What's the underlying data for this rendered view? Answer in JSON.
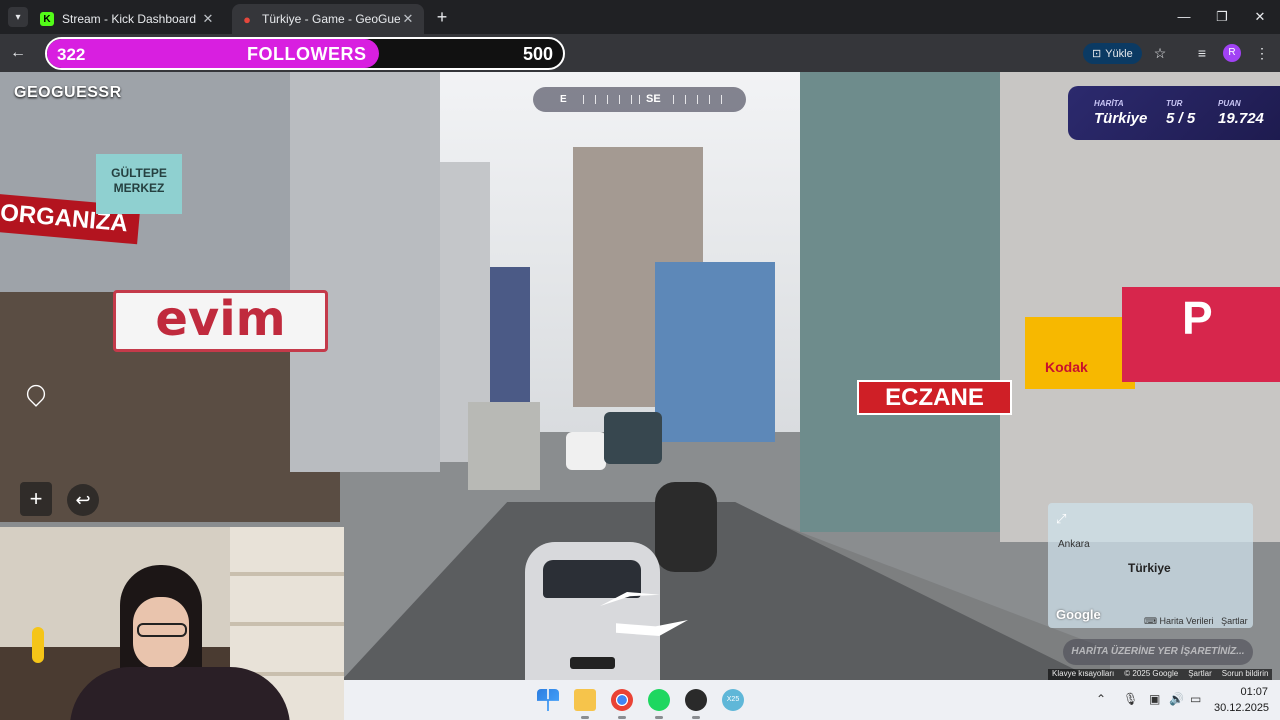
{
  "browser": {
    "tabs": [
      {
        "title": "Stream - Kick Dashboard",
        "icon": "kick-icon"
      },
      {
        "title": "Türkiye - Game - GeoGuessr",
        "icon": "geoguessr-pin-icon"
      }
    ],
    "install_label": "Yükle",
    "profile_initial": "R"
  },
  "follower_goal": {
    "current": "322",
    "label": "FOLLOWERS",
    "goal": "500",
    "progress": 0.644,
    "color": "#d81fe0"
  },
  "game": {
    "logo": "GEOGUESSR",
    "compass": {
      "left": "E",
      "center": "SE"
    },
    "status": {
      "map_label": "HARİTA",
      "map_value": "Türkiye",
      "round_label": "TUR",
      "round_value": "5 / 5",
      "score_label": "PUAN",
      "score_value": "19.724"
    },
    "minimap": {
      "city": "Ankara",
      "country": "Türkiye",
      "google": "Google",
      "map_data": "Harita Verileri",
      "terms": "Şartlar"
    },
    "guess_button": "HARİTA ÜZERİNE YER İŞARETİNİZ...",
    "footer": {
      "shortcuts": "Klavye kısayolları",
      "copyright": "© 2025 Google",
      "terms": "Şartlar",
      "report": "Sorun bildirin"
    }
  },
  "scene_signs": {
    "organiza": "ORGANIZA",
    "evim": "evim",
    "merkez": "GÜLTEPE MERKEZ",
    "eczane": "ECZANE",
    "kodak": "Kodak"
  },
  "taskbar": {
    "time": "01:07",
    "date": "30.12.2025",
    "other_app_label": "X25"
  }
}
